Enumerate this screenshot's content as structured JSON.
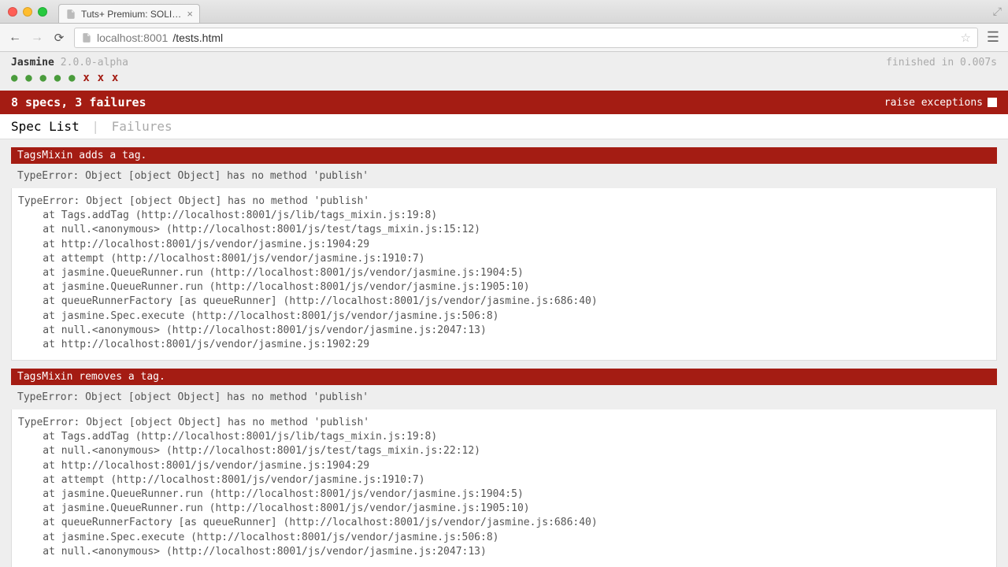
{
  "chrome": {
    "tab_title": "Tuts+ Premium: SOLID De",
    "url_host": "localhost",
    "url_port": ":8001",
    "url_path": "/tests.html",
    "close_glyph": "×",
    "expand_glyph": "⤢"
  },
  "jasmine": {
    "title": "Jasmine",
    "version": "2.0.0-alpha",
    "finished": "finished in 0.007s",
    "passes": [
      "●",
      "●",
      "●",
      "●",
      "●"
    ],
    "fails": [
      "x",
      "x",
      "x"
    ],
    "summary": "8 specs, 3 failures",
    "raise_exceptions": "raise exceptions",
    "tab_spec_list": "Spec List",
    "tab_failures": "Failures"
  },
  "failures": [
    {
      "title": "TagsMixin adds a tag.",
      "message": "TypeError: Object [object Object] has no method 'publish'",
      "stack": "TypeError: Object [object Object] has no method 'publish'\n    at Tags.addTag (http://localhost:8001/js/lib/tags_mixin.js:19:8)\n    at null.<anonymous> (http://localhost:8001/js/test/tags_mixin.js:15:12)\n    at http://localhost:8001/js/vendor/jasmine.js:1904:29\n    at attempt (http://localhost:8001/js/vendor/jasmine.js:1910:7)\n    at jasmine.QueueRunner.run (http://localhost:8001/js/vendor/jasmine.js:1904:5)\n    at jasmine.QueueRunner.run (http://localhost:8001/js/vendor/jasmine.js:1905:10)\n    at queueRunnerFactory [as queueRunner] (http://localhost:8001/js/vendor/jasmine.js:686:40)\n    at jasmine.Spec.execute (http://localhost:8001/js/vendor/jasmine.js:506:8)\n    at null.<anonymous> (http://localhost:8001/js/vendor/jasmine.js:2047:13)\n    at http://localhost:8001/js/vendor/jasmine.js:1902:29"
    },
    {
      "title": "TagsMixin removes a tag.",
      "message": "TypeError: Object [object Object] has no method 'publish'",
      "stack": "TypeError: Object [object Object] has no method 'publish'\n    at Tags.addTag (http://localhost:8001/js/lib/tags_mixin.js:19:8)\n    at null.<anonymous> (http://localhost:8001/js/test/tags_mixin.js:22:12)\n    at http://localhost:8001/js/vendor/jasmine.js:1904:29\n    at attempt (http://localhost:8001/js/vendor/jasmine.js:1910:7)\n    at jasmine.QueueRunner.run (http://localhost:8001/js/vendor/jasmine.js:1904:5)\n    at jasmine.QueueRunner.run (http://localhost:8001/js/vendor/jasmine.js:1905:10)\n    at queueRunnerFactory [as queueRunner] (http://localhost:8001/js/vendor/jasmine.js:686:40)\n    at jasmine.Spec.execute (http://localhost:8001/js/vendor/jasmine.js:506:8)\n    at null.<anonymous> (http://localhost:8001/js/vendor/jasmine.js:2047:13)"
    }
  ]
}
